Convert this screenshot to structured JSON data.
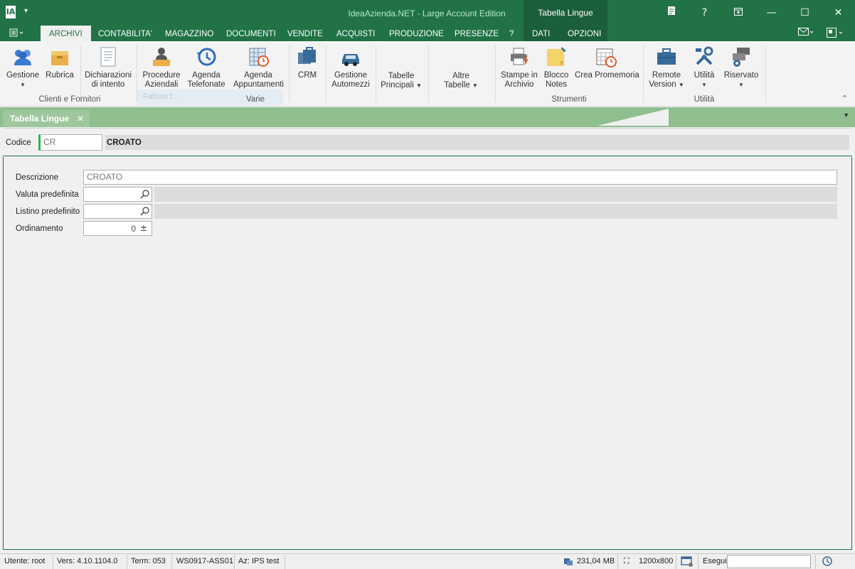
{
  "titlebar": {
    "app_logo": "IA",
    "title": "IdeaAzienda.NET - Large Account Edition",
    "context_tab_title": "Tabella Lingue"
  },
  "ribbon_tabs": [
    "ARCHIVI",
    "CONTABILITA'",
    "MAGAZZINO",
    "DOCUMENTI",
    "VENDITE",
    "ACQUISTI",
    "PRODUZIONE",
    "PRESENZE",
    "?",
    "DATI",
    "OPZIONI"
  ],
  "ribbon": {
    "gestione": "Gestione",
    "rubrica": "Rubrica",
    "dichiarazioni_1": "Dichiarazioni",
    "dichiarazioni_2": "di intento",
    "procedure_1": "Procedure",
    "procedure_2": "Aziendali",
    "agenda_tel_1": "Agenda",
    "agenda_tel_2": "Telefonate",
    "agenda_app_1": "Agenda",
    "agenda_app_2": "Appuntamenti",
    "crm": "CRM",
    "automezzi_1": "Gestione",
    "automezzi_2": "Automezzi",
    "tab_princ_1": "Tabelle",
    "tab_princ_2": "Principali",
    "altre_tab_1": "Altre",
    "altre_tab_2": "Tabelle",
    "stampe_1": "Stampe in",
    "stampe_2": "Archivio",
    "blocco_1": "Blocco",
    "blocco_2": "Notes",
    "promemoria": "Crea Promemoria",
    "remote_1": "Remote",
    "remote_2": "Version",
    "utilita": "Utilità",
    "riservato": "Riservato",
    "group_clienti": "Clienti e Fornitori",
    "group_varie": "Varie",
    "group_strumenti": "Strumenti",
    "group_utilita": "Utilità",
    "ghost_text": "Fattura f..."
  },
  "doc_tab": {
    "label": "Tabella Lingue"
  },
  "header": {
    "codice_label": "Codice",
    "codice_value": "CR",
    "descrizione_value": "CROATO"
  },
  "form": {
    "descrizione_label": "Descrizione",
    "descrizione_value": "CROATO",
    "valuta_label": "Valuta predefinita",
    "listino_label": "Listino predefinito",
    "ordinamento_label": "Ordinamento",
    "ordinamento_value": "0"
  },
  "statusbar": {
    "utente": "Utente: root",
    "vers": "Vers: 4.10.1104.0",
    "term": "Term: 053",
    "ws": "WS0917-ASS01",
    "az": "Az: IPS test",
    "memory": "231,04 MB",
    "resolution": "1200x800",
    "esegui": "Esegui"
  },
  "colors": {
    "accent": "#217346",
    "doc_tab_bar": "#8fbf8f",
    "codice_marker": "#2fb34a"
  }
}
